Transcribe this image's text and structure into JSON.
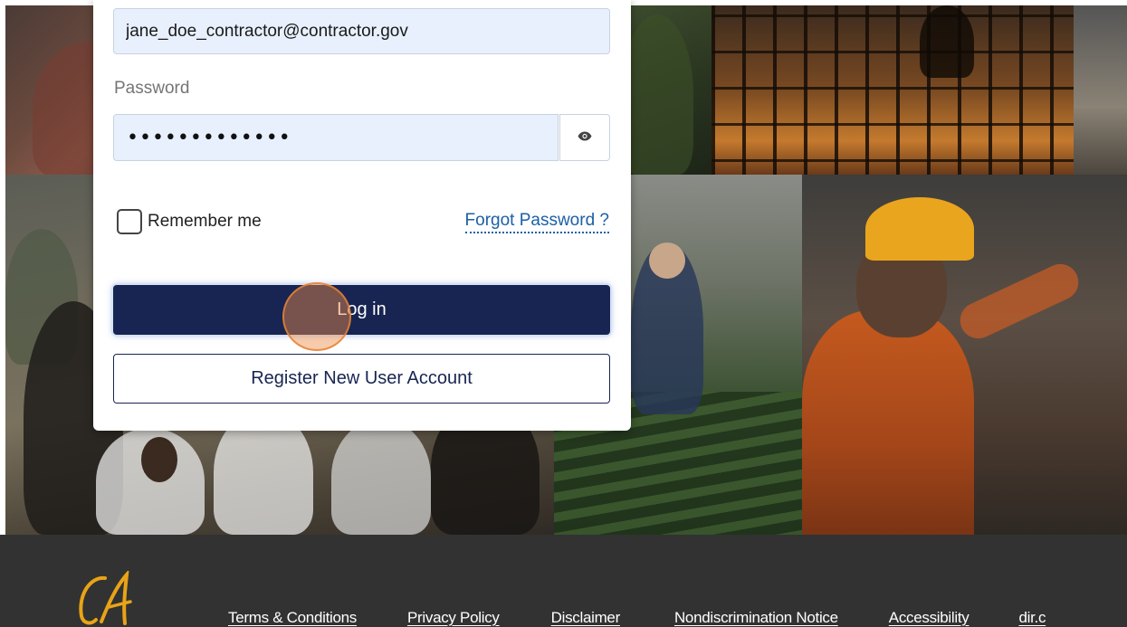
{
  "login": {
    "email_value": "jane_doe_contractor@contractor.gov",
    "password_label": "Password",
    "password_value": "•••••••••••••",
    "remember_label": "Remember me",
    "forgot_label": "Forgot Password ?",
    "login_label": "Log in",
    "register_label": "Register New User Account"
  },
  "footer": {
    "links": [
      "Terms & Conditions",
      "Privacy Policy",
      "Disclaimer",
      "Nondiscrimination Notice",
      "Accessibility",
      "dir.c"
    ]
  },
  "colors": {
    "primary": "#182552",
    "input_bg": "#e8f0fe",
    "link": "#1b5fa6",
    "footer_bg": "#323232",
    "logo_gold": "#e8a317"
  }
}
